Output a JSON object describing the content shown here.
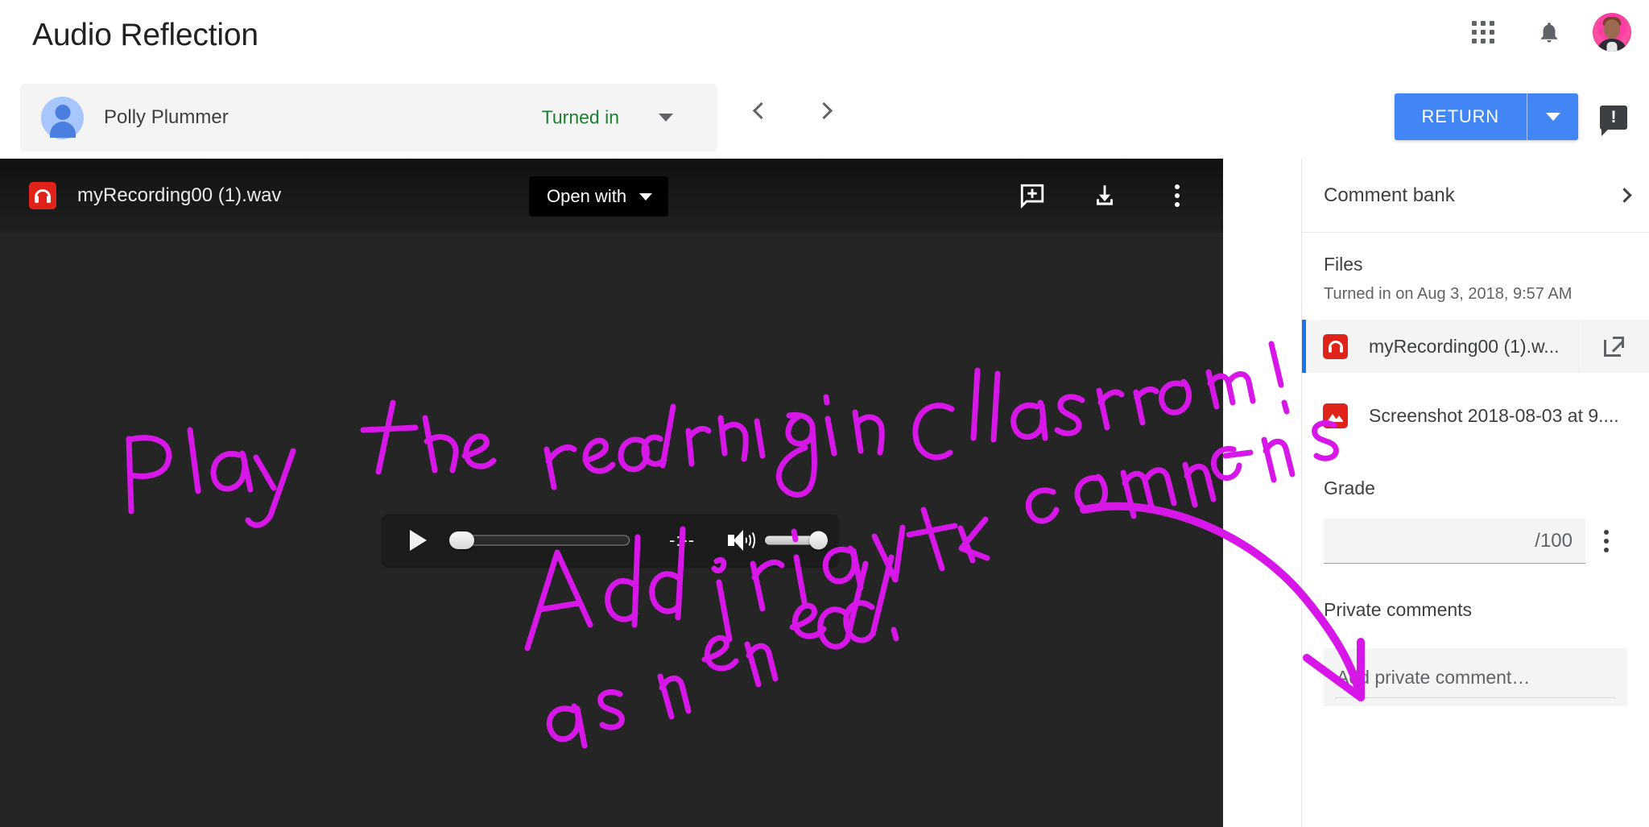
{
  "header": {
    "title": "Audio Reflection",
    "apps_icon": "apps-grid-icon",
    "notifications_icon": "bell-icon",
    "account_icon": "avatar"
  },
  "student": {
    "name": "Polly Plummer",
    "status": "Turned in",
    "status_caret_icon": "chevron-down-icon",
    "avatar_icon": "person-avatar"
  },
  "nav": {
    "prev_icon": "chevron-left-icon",
    "next_icon": "chevron-right-icon"
  },
  "actions": {
    "return_label": "RETURN",
    "return_caret_icon": "chevron-down-icon",
    "flag_icon": "report-issue-icon",
    "return_color": "#4285f4"
  },
  "viewer": {
    "filename": "myRecording00 (1).wav",
    "file_icon": "audio-headphone-icon",
    "open_with_label": "Open with",
    "open_with_caret_icon": "chevron-down-icon",
    "add_comment_icon": "add-comment-icon",
    "download_icon": "download-icon",
    "more_icon": "more-vert-icon",
    "background_color": "#252525"
  },
  "player": {
    "play_icon": "play-icon",
    "time": "-:--",
    "volume_icon": "volume-up-icon",
    "seek_position_percent": 0,
    "volume_percent": 100
  },
  "annotations": {
    "line1": "Play the recording in Classroom!",
    "line2": "Add private comments",
    "line3": "as needed.",
    "ink_color": "#d717e8",
    "arrow_icon": "curved-arrow-annotation"
  },
  "sidebar": {
    "comment_bank": {
      "label": "Comment bank",
      "expand_icon": "chevron-right-icon"
    },
    "files": {
      "heading": "Files",
      "turned_in_text": "Turned in on Aug 3, 2018, 9:57 AM",
      "items": [
        {
          "name": "myRecording00 (1).w...",
          "icon": "audio-headphone-icon",
          "selected": true,
          "open_icon": "open-in-new-icon"
        },
        {
          "name": "Screenshot 2018-08-03 at 9....",
          "icon": "image-file-icon",
          "selected": false
        }
      ]
    },
    "grade": {
      "label": "Grade",
      "value": "",
      "max_suffix": "/100",
      "more_icon": "more-vert-icon"
    },
    "private_comments": {
      "label": "Private comments",
      "placeholder": "Add private comment…",
      "value": ""
    }
  }
}
